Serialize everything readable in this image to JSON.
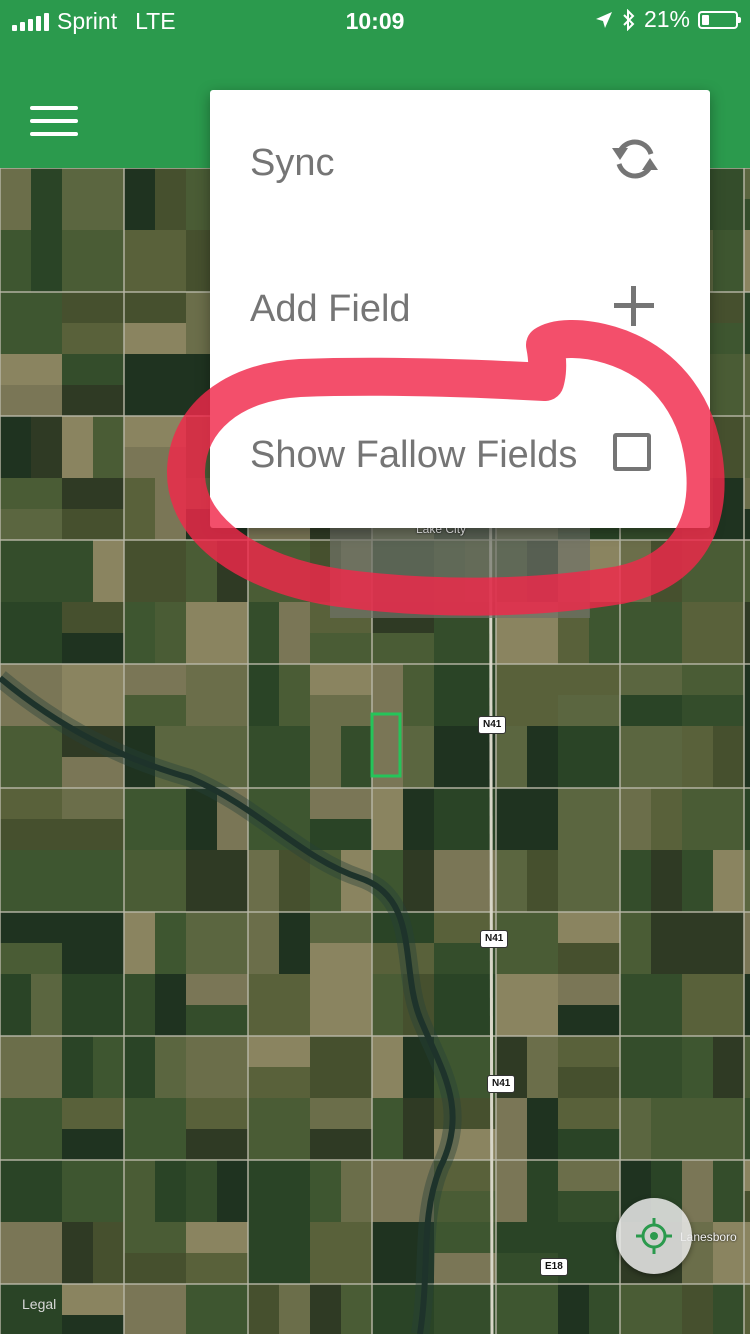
{
  "status_bar": {
    "carrier": "Sprint",
    "network": "LTE",
    "time": "10:09",
    "battery_percent": "21%",
    "battery_level": 0.21
  },
  "menu": {
    "items": [
      {
        "label": "Sync",
        "icon": "sync-icon"
      },
      {
        "label": "Add Field",
        "icon": "plus-icon"
      },
      {
        "label": "Show Fallow Fields",
        "icon": "checkbox",
        "checked": false
      }
    ]
  },
  "map": {
    "town": "Lake City",
    "town_label_2": "Lanesboro",
    "road_shields": [
      "N41",
      "N41",
      "N41",
      "E18"
    ],
    "legal": "Legal",
    "locate_icon": "crosshair-icon"
  },
  "colors": {
    "brand_green": "#2b9a4d",
    "menu_text": "#757575",
    "annotation_red": "#f0284a"
  }
}
